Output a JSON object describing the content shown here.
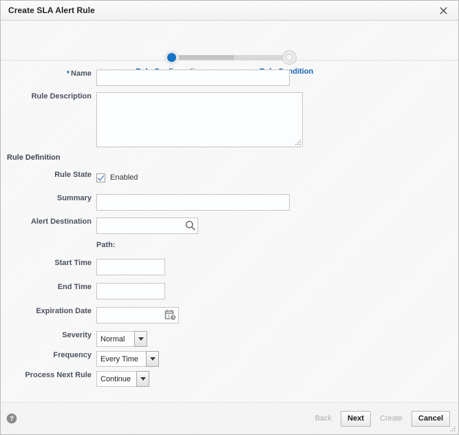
{
  "dialog": {
    "title": "Create SLA Alert Rule",
    "close_icon": "close-icon"
  },
  "train": {
    "steps": [
      {
        "label": "Rule Configuration",
        "state": "current"
      },
      {
        "label": "Rule Condition",
        "state": "upcoming"
      }
    ]
  },
  "form": {
    "name": {
      "label": "Name",
      "required_marker": "*",
      "value": "",
      "placeholder": ""
    },
    "rule_description": {
      "label": "Rule Description",
      "value": "",
      "placeholder": ""
    },
    "section_title": "Rule Definition",
    "rule_state": {
      "label": "Rule State",
      "checkbox_label": "Enabled",
      "checked": true
    },
    "summary": {
      "label": "Summary",
      "value": "",
      "placeholder": ""
    },
    "alert_destination": {
      "label": "Alert Destination",
      "value": "",
      "placeholder": "",
      "icon": "search-icon"
    },
    "path": {
      "label": "Path:",
      "value": ""
    },
    "start_time": {
      "label": "Start Time",
      "value": "",
      "placeholder": ""
    },
    "end_time": {
      "label": "End Time",
      "value": "",
      "placeholder": ""
    },
    "expiration_date": {
      "label": "Expiration Date",
      "value": "",
      "placeholder": "",
      "icon": "calendar-clock-icon"
    },
    "severity": {
      "label": "Severity",
      "value": "Normal"
    },
    "frequency": {
      "label": "Frequency",
      "value": "Every Time"
    },
    "process_next_rule": {
      "label": "Process Next Rule",
      "value": "Continue"
    }
  },
  "footer": {
    "help_icon": "help-icon",
    "buttons": [
      {
        "label": "Back",
        "enabled": false
      },
      {
        "label": "Next",
        "enabled": true
      },
      {
        "label": "Create",
        "enabled": false
      },
      {
        "label": "Cancel",
        "enabled": true
      }
    ]
  },
  "colors": {
    "accent_blue": "#1474c4",
    "link_blue": "#1565b5",
    "label_gray": "#4a5160"
  }
}
